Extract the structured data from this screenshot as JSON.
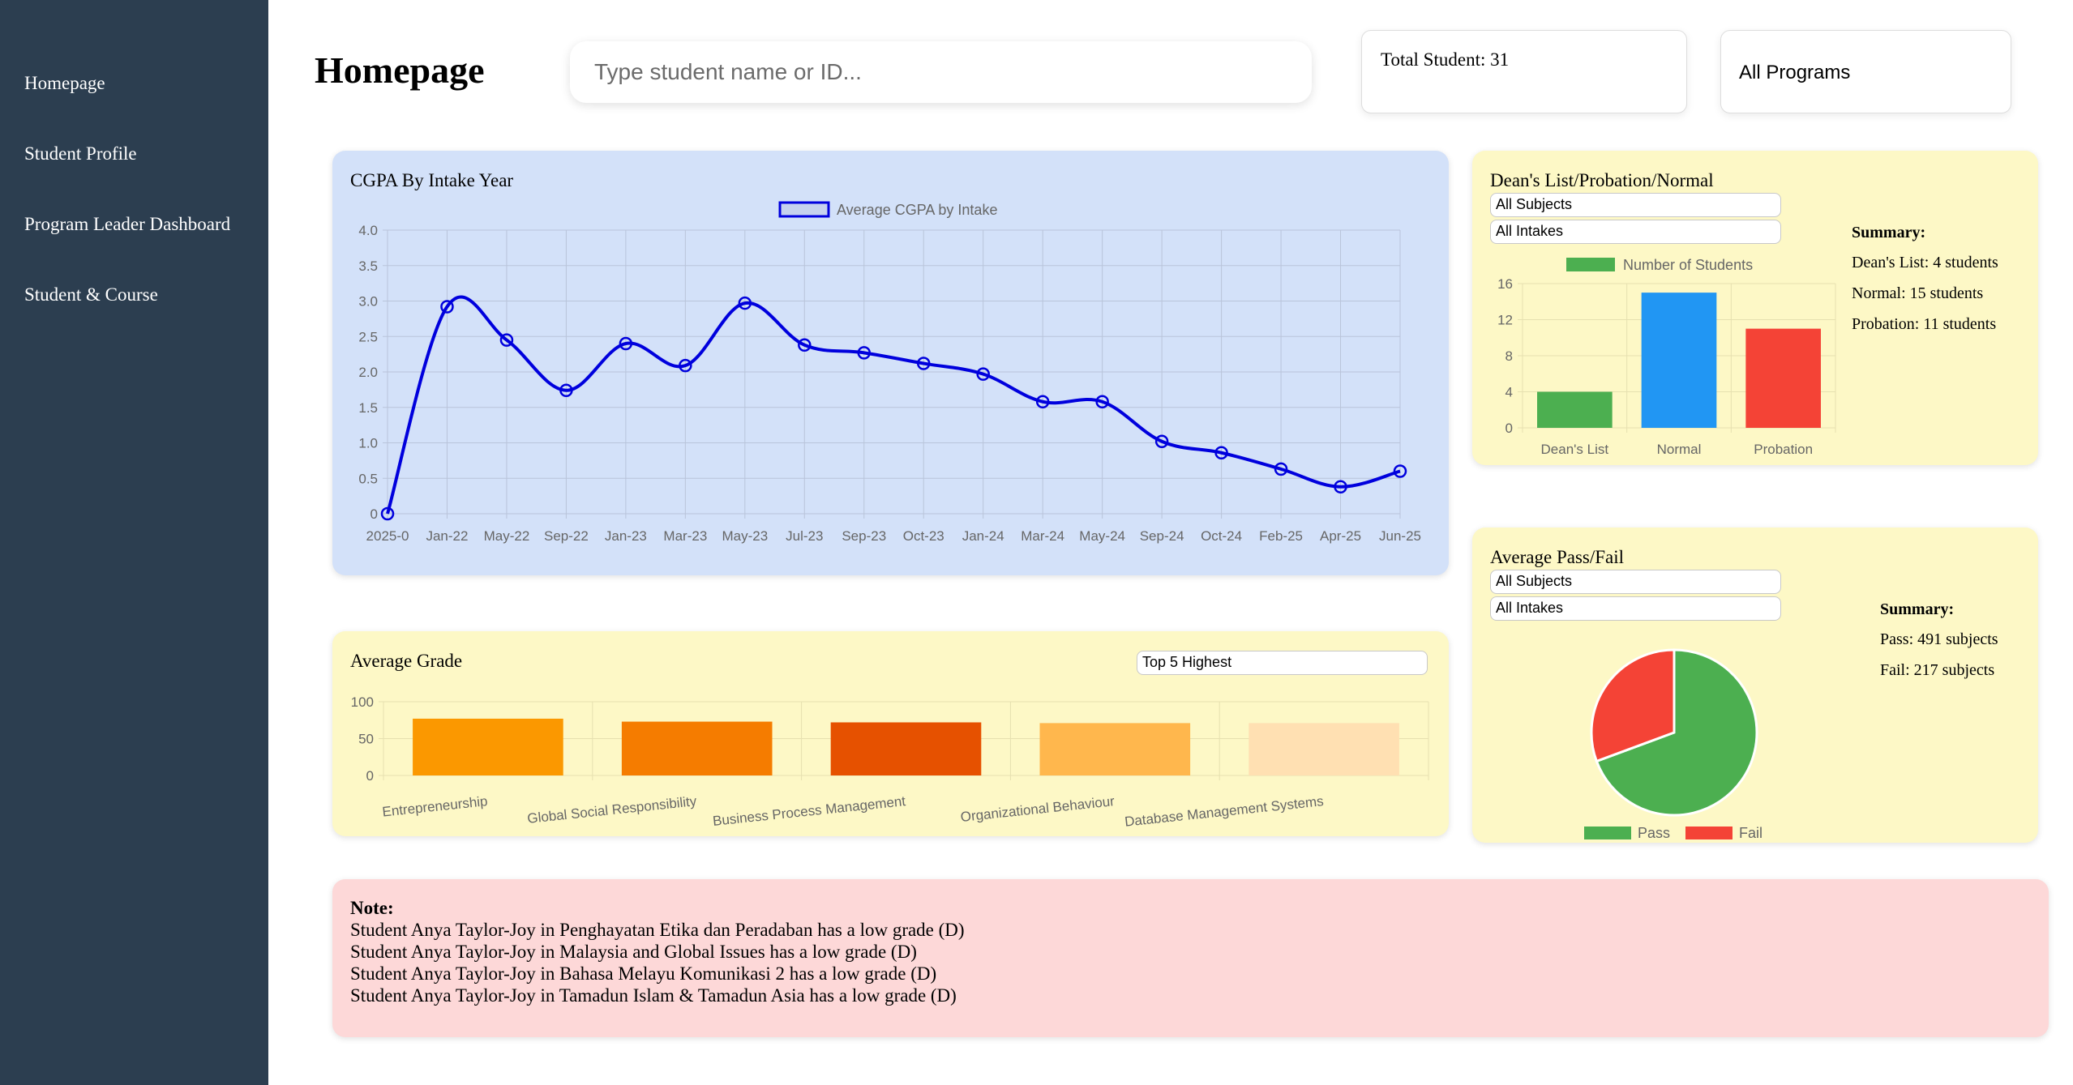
{
  "sidebar": {
    "items": [
      {
        "label": "Homepage"
      },
      {
        "label": "Student Profile"
      },
      {
        "label": "Program Leader Dashboard"
      },
      {
        "label": "Student & Course"
      }
    ]
  },
  "header": {
    "title": "Homepage",
    "search_placeholder": "Type student name or ID...",
    "total_students": "Total Student: 31",
    "program_filter": "All Programs"
  },
  "cgpa_card": {
    "title": "CGPA By Intake Year"
  },
  "grade_card": {
    "title": "Average Grade",
    "filter": "Top 5 Highest"
  },
  "deans_card": {
    "title": "Dean's List/Probation/Normal",
    "subject_filter": "All Subjects",
    "intake_filter": "All Intakes",
    "summary_title": "Summary:",
    "summary": [
      "Dean's List: 4 students",
      "Normal: 15 students",
      "Probation: 11 students"
    ]
  },
  "passfail_card": {
    "title": "Average Pass/Fail",
    "subject_filter": "All Subjects",
    "intake_filter": "All Intakes",
    "summary_title": "Summary:",
    "summary": [
      "Pass: 491 subjects",
      "Fail: 217 subjects"
    ]
  },
  "note": {
    "title": "Note:",
    "lines": [
      "Student Anya Taylor-Joy in Penghayatan Etika dan Peradaban has a low grade (D)",
      "Student Anya Taylor-Joy in Malaysia and Global Issues has a low grade (D)",
      "Student Anya Taylor-Joy in Bahasa Melayu Komunikasi 2 has a low grade (D)",
      "Student Anya Taylor-Joy in Tamadun Islam & Tamadun Asia has a low grade (D)"
    ]
  },
  "chart_data": [
    {
      "type": "line",
      "legend": "Average CGPA by Intake",
      "categories": [
        "2025-0",
        "Jan-22",
        "May-22",
        "Sep-22",
        "Jan-23",
        "Mar-23",
        "May-23",
        "Jul-23",
        "Sep-23",
        "Oct-23",
        "Jan-24",
        "Mar-24",
        "May-24",
        "Sep-24",
        "Oct-24",
        "Feb-25",
        "Apr-25",
        "Jun-25"
      ],
      "values": [
        0,
        2.92,
        2.45,
        1.74,
        2.4,
        2.09,
        2.97,
        2.38,
        2.27,
        2.12,
        1.97,
        1.58,
        1.58,
        1.02,
        0.86,
        0.63,
        0.38,
        0.6
      ],
      "ylim": [
        0,
        4
      ],
      "yticks": [
        "0",
        "0.5",
        "1.0",
        "1.5",
        "2.0",
        "2.5",
        "3.0",
        "3.5",
        "4.0"
      ],
      "color": "#0000dd",
      "grid": true,
      "legend_position": "top"
    },
    {
      "type": "bar",
      "categories": [
        "Entrepreneurship",
        "Global Social Responsibility",
        "Business Process Management",
        "Organizational Behaviour",
        "Database Management Systems"
      ],
      "values": [
        77,
        73,
        72,
        71,
        71
      ],
      "ylim": [
        0,
        100
      ],
      "yticks": [
        "0",
        "50",
        "100"
      ],
      "colors": [
        "#fb9800",
        "#f57c00",
        "#e65100",
        "#ffb74d",
        "#ffe0b2"
      ],
      "grid": true
    },
    {
      "type": "bar",
      "legend": "Number of Students",
      "categories": [
        "Dean's List",
        "Normal",
        "Probation"
      ],
      "values": [
        4,
        15,
        11
      ],
      "ylim": [
        0,
        16
      ],
      "yticks": [
        "0",
        "4",
        "8",
        "12",
        "16"
      ],
      "colors": [
        "#4caf50",
        "#2196f3",
        "#f44336"
      ],
      "grid": true,
      "legend_position": "top"
    },
    {
      "type": "pie",
      "categories": [
        "Pass",
        "Fail"
      ],
      "values": [
        491,
        217
      ],
      "colors": [
        "#4caf50",
        "#f44336"
      ],
      "legend_position": "bottom"
    }
  ]
}
